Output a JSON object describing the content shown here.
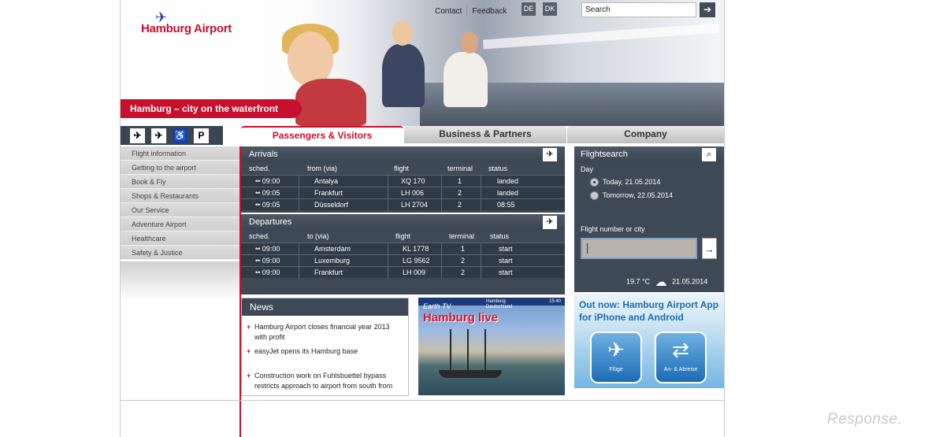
{
  "header": {
    "logo_text": "Hamburg Airport",
    "tagline": "Hamburg – city on the waterfront",
    "links": [
      "Contact",
      "Feedback"
    ],
    "languages": [
      "DE",
      "DK"
    ],
    "search_value": "Search"
  },
  "nav": {
    "icons": [
      "arrivals-icon",
      "departures-icon",
      "wheelchair-icon",
      "parking-icon"
    ],
    "parking_label": "P",
    "items": [
      "Flight information",
      "Getting to the airport",
      "Book & Fly",
      "Shops & Restaurants",
      "Our Service",
      "Adventure Airport",
      "Healthcare",
      "Safety & Justice"
    ]
  },
  "tabs": [
    "Passengers & Visitors",
    "Business & Partners",
    "Company"
  ],
  "arrivals": {
    "title": "Arrivals",
    "columns": [
      "sched.",
      "from (via)",
      "flight",
      "terminal",
      "status"
    ],
    "rows": [
      {
        "time": "•• 09:00",
        "city": "Antalya",
        "flight": "XQ 170",
        "terminal": "1",
        "status": "landed"
      },
      {
        "time": "•• 09:05",
        "city": "Frankfurt",
        "flight": "LH 006",
        "terminal": "2",
        "status": "landed"
      },
      {
        "time": "•• 09:05",
        "city": "Düsseldorf",
        "flight": "LH 2704",
        "terminal": "2",
        "status": "08:55"
      }
    ]
  },
  "departures": {
    "title": "Departures",
    "columns": [
      "sched.",
      "to (via)",
      "flight",
      "terminal",
      "status"
    ],
    "rows": [
      {
        "time": "•• 09:00",
        "city": "Amsterdam",
        "flight": "KL 1778",
        "terminal": "1",
        "status": "start"
      },
      {
        "time": "•• 09:00",
        "city": "Luxemburg",
        "flight": "LG 9562",
        "terminal": "2",
        "status": "start"
      },
      {
        "time": "•• 09:00",
        "city": "Frankfurt",
        "flight": "LH 009",
        "terminal": "2",
        "status": "start"
      }
    ]
  },
  "flightsearch": {
    "title": "Flightsearch",
    "day_label": "Day",
    "options": [
      "Today, 21.05.2014",
      "Tomorrow, 22.05.2014"
    ],
    "selected": 0,
    "field_label": "Flight number or city",
    "temperature": "19.7 °C",
    "date": "21.05.2014"
  },
  "news": {
    "title": "News",
    "items": [
      "Hamburg Airport closes financial year 2013 with profit",
      "easyJet opens its Hamburg base",
      "Construction work on Fuhlsbuettel bypass restricts approach to airport from south from"
    ]
  },
  "tv": {
    "subtitle": "Earth TV",
    "title": "Hamburg live",
    "city": "Hamburg",
    "country": "Deutschland",
    "clock": "15:40"
  },
  "app": {
    "title": "Out now: Hamburg Airport App for iPhone and Android",
    "tiles": [
      "Flüge",
      "An- & Abreise"
    ]
  },
  "watermark": "Response."
}
